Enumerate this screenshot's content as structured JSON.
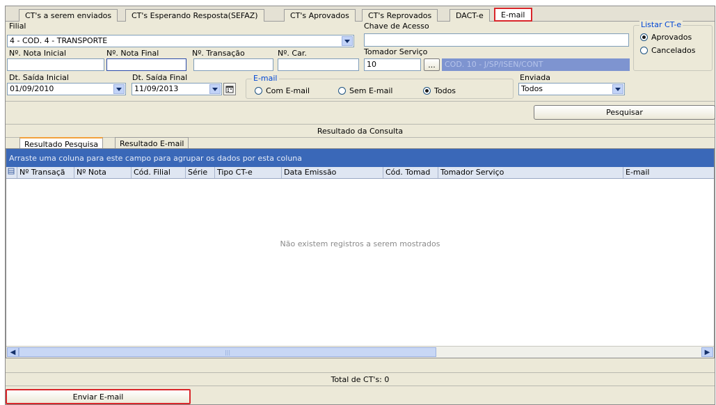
{
  "tabs": [
    {
      "label": "CT's a serem enviados"
    },
    {
      "label": "CT's Esperando Resposta(SEFAZ)"
    },
    {
      "label": "CT's Aprovados"
    },
    {
      "label": "CT's Reprovados"
    },
    {
      "label": "DACT-e"
    },
    {
      "label": "E-mail"
    }
  ],
  "filters": {
    "filial_label": "Filial",
    "filial_value": "4 - COD. 4 - TRANSPORTE",
    "chave_label": "Chave de Acesso",
    "chave_value": "",
    "nota_inicial_label": "Nº. Nota Inicial",
    "nota_final_label": "Nº. Nota Final",
    "transacao_label": "Nº. Transação",
    "car_label": "Nº. Car.",
    "tomador_label": "Tomador Serviço",
    "tomador_code": "10",
    "tomador_browse": "...",
    "tomador_desc": "COD. 10 - J/SP/ISEN/CONT",
    "dt_inicial_label": "Dt. Saída Inicial",
    "dt_inicial_value": "01/09/2010",
    "dt_final_label": "Dt. Saída Final",
    "dt_final_value": "11/09/2013",
    "email_group_label": "E-mail",
    "email_options": [
      "Com E-mail",
      "Sem E-mail",
      "Todos"
    ],
    "email_selected": "Todos",
    "enviada_label": "Enviada",
    "enviada_value": "Todos",
    "listar_label": "Listar CT-e",
    "listar_options": [
      "Aprovados",
      "Cancelados"
    ],
    "listar_selected": "Aprovados"
  },
  "pesquisar_label": "Pesquisar",
  "result_title": "Resultado da Consulta",
  "subtabs": [
    {
      "label": "Resultado Pesquisa"
    },
    {
      "label": "Resultado E-mail"
    }
  ],
  "grid": {
    "group_hint": "Arraste uma coluna para este campo para agrupar os dados por esta coluna",
    "columns": [
      "Nº Transaçã",
      "Nº Nota",
      "Cód. Filial",
      "Série",
      "Tipo CT-e",
      "Data Emissão",
      "Cód. Tomad",
      "Tomador Serviço",
      "E-mail"
    ],
    "empty_message": "Não existem registros a serem mostrados"
  },
  "total_label": "Total de CT's: 0",
  "enviar_label": "Enviar E-mail",
  "colors": {
    "accent_blue": "#3a68b8",
    "highlight_red": "#d9252a",
    "panel": "#ece9d8"
  }
}
